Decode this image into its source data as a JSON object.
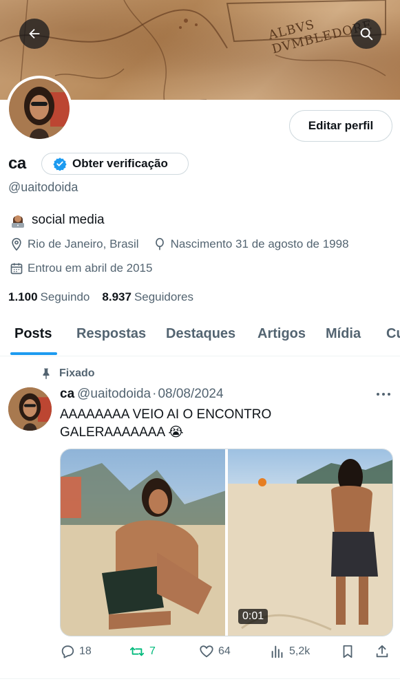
{
  "header": {
    "banner_text": "ALBVS DVMBLEDORE",
    "back_label": "Voltar",
    "search_label": "Pesquisar"
  },
  "profile": {
    "edit_button": "Editar perfil",
    "name": "ca",
    "verify_label": "Obter verificação",
    "handle": "@uaitodoida",
    "bio": "social media",
    "location": "Rio de Janeiro, Brasil",
    "birthday": "Nascimento 31 de agosto de 1998",
    "joined": "Entrou em abril de 2015",
    "following_count": "1.100",
    "following_label": "Seguindo",
    "followers_count": "8.937",
    "followers_label": "Seguidores"
  },
  "tabs": [
    {
      "label": "Posts",
      "active": true
    },
    {
      "label": "Respostas",
      "active": false
    },
    {
      "label": "Destaques",
      "active": false
    },
    {
      "label": "Artigos",
      "active": false
    },
    {
      "label": "Mídia",
      "active": false
    },
    {
      "label": "Cu",
      "active": false
    }
  ],
  "tweet": {
    "pinned_label": "Fixado",
    "name": "ca",
    "handle": "@uaitodoida",
    "separator": "·",
    "date": "08/08/2024",
    "text_line1": "AAAAAAAA VEIO AI O ENCONTRO",
    "text_line2": "GALERAAAAAAA 😭",
    "video_duration": "0:01",
    "replies": "18",
    "reposts": "7",
    "likes": "64",
    "views": "5,2k"
  },
  "colors": {
    "accent": "#1d9bf0",
    "repost_green": "#00ba7c",
    "secondary_text": "#536471",
    "primary_text": "#0f1419"
  }
}
